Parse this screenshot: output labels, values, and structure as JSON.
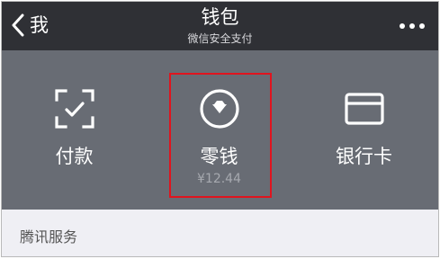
{
  "header": {
    "back_label": "我",
    "title": "钱包",
    "subtitle": "微信安全支付",
    "back_icon": "chevron-left-icon",
    "more_icon": "more-dots-icon"
  },
  "wallet": {
    "items": [
      {
        "label": "付款",
        "icon": "scan-pay-icon"
      },
      {
        "label": "零钱",
        "amount": "¥12.44",
        "icon": "diamond-coin-icon",
        "highlighted": true
      },
      {
        "label": "银行卡",
        "icon": "bank-card-icon"
      }
    ]
  },
  "services": {
    "title": "腾讯服务"
  },
  "colors": {
    "navbar_bg": "#2f3035",
    "panel_bg": "#686c74",
    "highlight_border": "#e0141e",
    "page_bg": "#efeff4"
  }
}
